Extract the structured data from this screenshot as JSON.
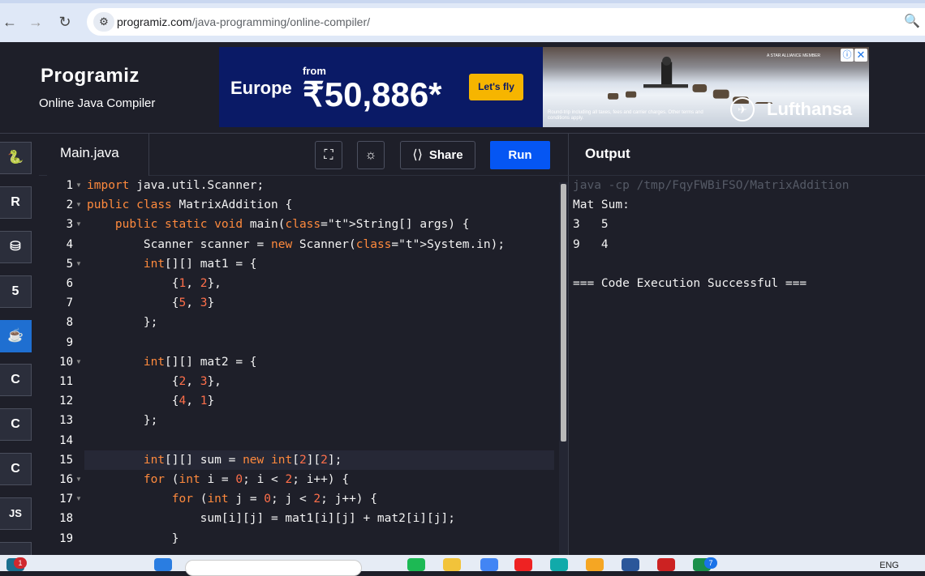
{
  "browser": {
    "url_domain": "programiz.com",
    "url_path": "/java-programming/online-compiler/"
  },
  "header": {
    "logo": "Programiz",
    "subtitle": "Online Java Compiler"
  },
  "ad": {
    "destination": "Europe",
    "from": "from",
    "price": "₹50,886*",
    "cta": "Let's fly",
    "brand": "Lufthansa",
    "member": "A STAR ALLIANCE MEMBER",
    "fine_print": "Round-trip including all taxes, fees and carrier charges. Other terms and conditions apply."
  },
  "sidebar": {
    "items": [
      {
        "icon": "python-icon",
        "glyph": "🐍"
      },
      {
        "icon": "r-icon",
        "glyph": "R"
      },
      {
        "icon": "sql-database-icon",
        "glyph": "⛁"
      },
      {
        "icon": "html5-icon",
        "glyph": "5"
      },
      {
        "icon": "java-icon",
        "glyph": "☕"
      },
      {
        "icon": "c-icon",
        "glyph": "C"
      },
      {
        "icon": "cpp-icon",
        "glyph": "C"
      },
      {
        "icon": "csharp-icon",
        "glyph": "C"
      },
      {
        "icon": "js-icon",
        "glyph": "JS"
      }
    ]
  },
  "editor": {
    "filename": "Main.java",
    "share_label": "Share",
    "run_label": "Run",
    "line_numbers": [
      "1",
      "2",
      "3",
      "4",
      "5",
      "6",
      "7",
      "8",
      "9",
      "10",
      "11",
      "12",
      "13",
      "14",
      "15",
      "16",
      "17",
      "18",
      "19"
    ],
    "lines": [
      "import java.util.Scanner;",
      "public class MatrixAddition {",
      "    public static void main(String[] args) {",
      "        Scanner scanner = new Scanner(System.in);",
      "        int[][] mat1 = {",
      "            {1, 2},",
      "            {5, 3}",
      "        };",
      "",
      "        int[][] mat2 = {",
      "            {2, 3},",
      "            {4, 1}",
      "        };",
      "",
      "        int[][] sum = new int[2][2];",
      "        for (int i = 0; i < 2; i++) {",
      "            for (int j = 0; j < 2; j++) {",
      "                sum[i][j] = mat1[i][j] + mat2[i][j];",
      "            }"
    ]
  },
  "output": {
    "title": "Output",
    "lines": [
      "java -cp /tmp/FqyFWBiFSO/MatrixAddition",
      "Mat Sum:",
      "3   5",
      "9   4",
      "",
      "=== Code Execution Successful ==="
    ]
  },
  "taskbar": {
    "notification_count": "1",
    "chrome_badge": "7",
    "language": "ENG"
  },
  "colors": {
    "run_button": "#0556f3",
    "background": "#1e1f29",
    "keyword": "#ff8a3d"
  }
}
